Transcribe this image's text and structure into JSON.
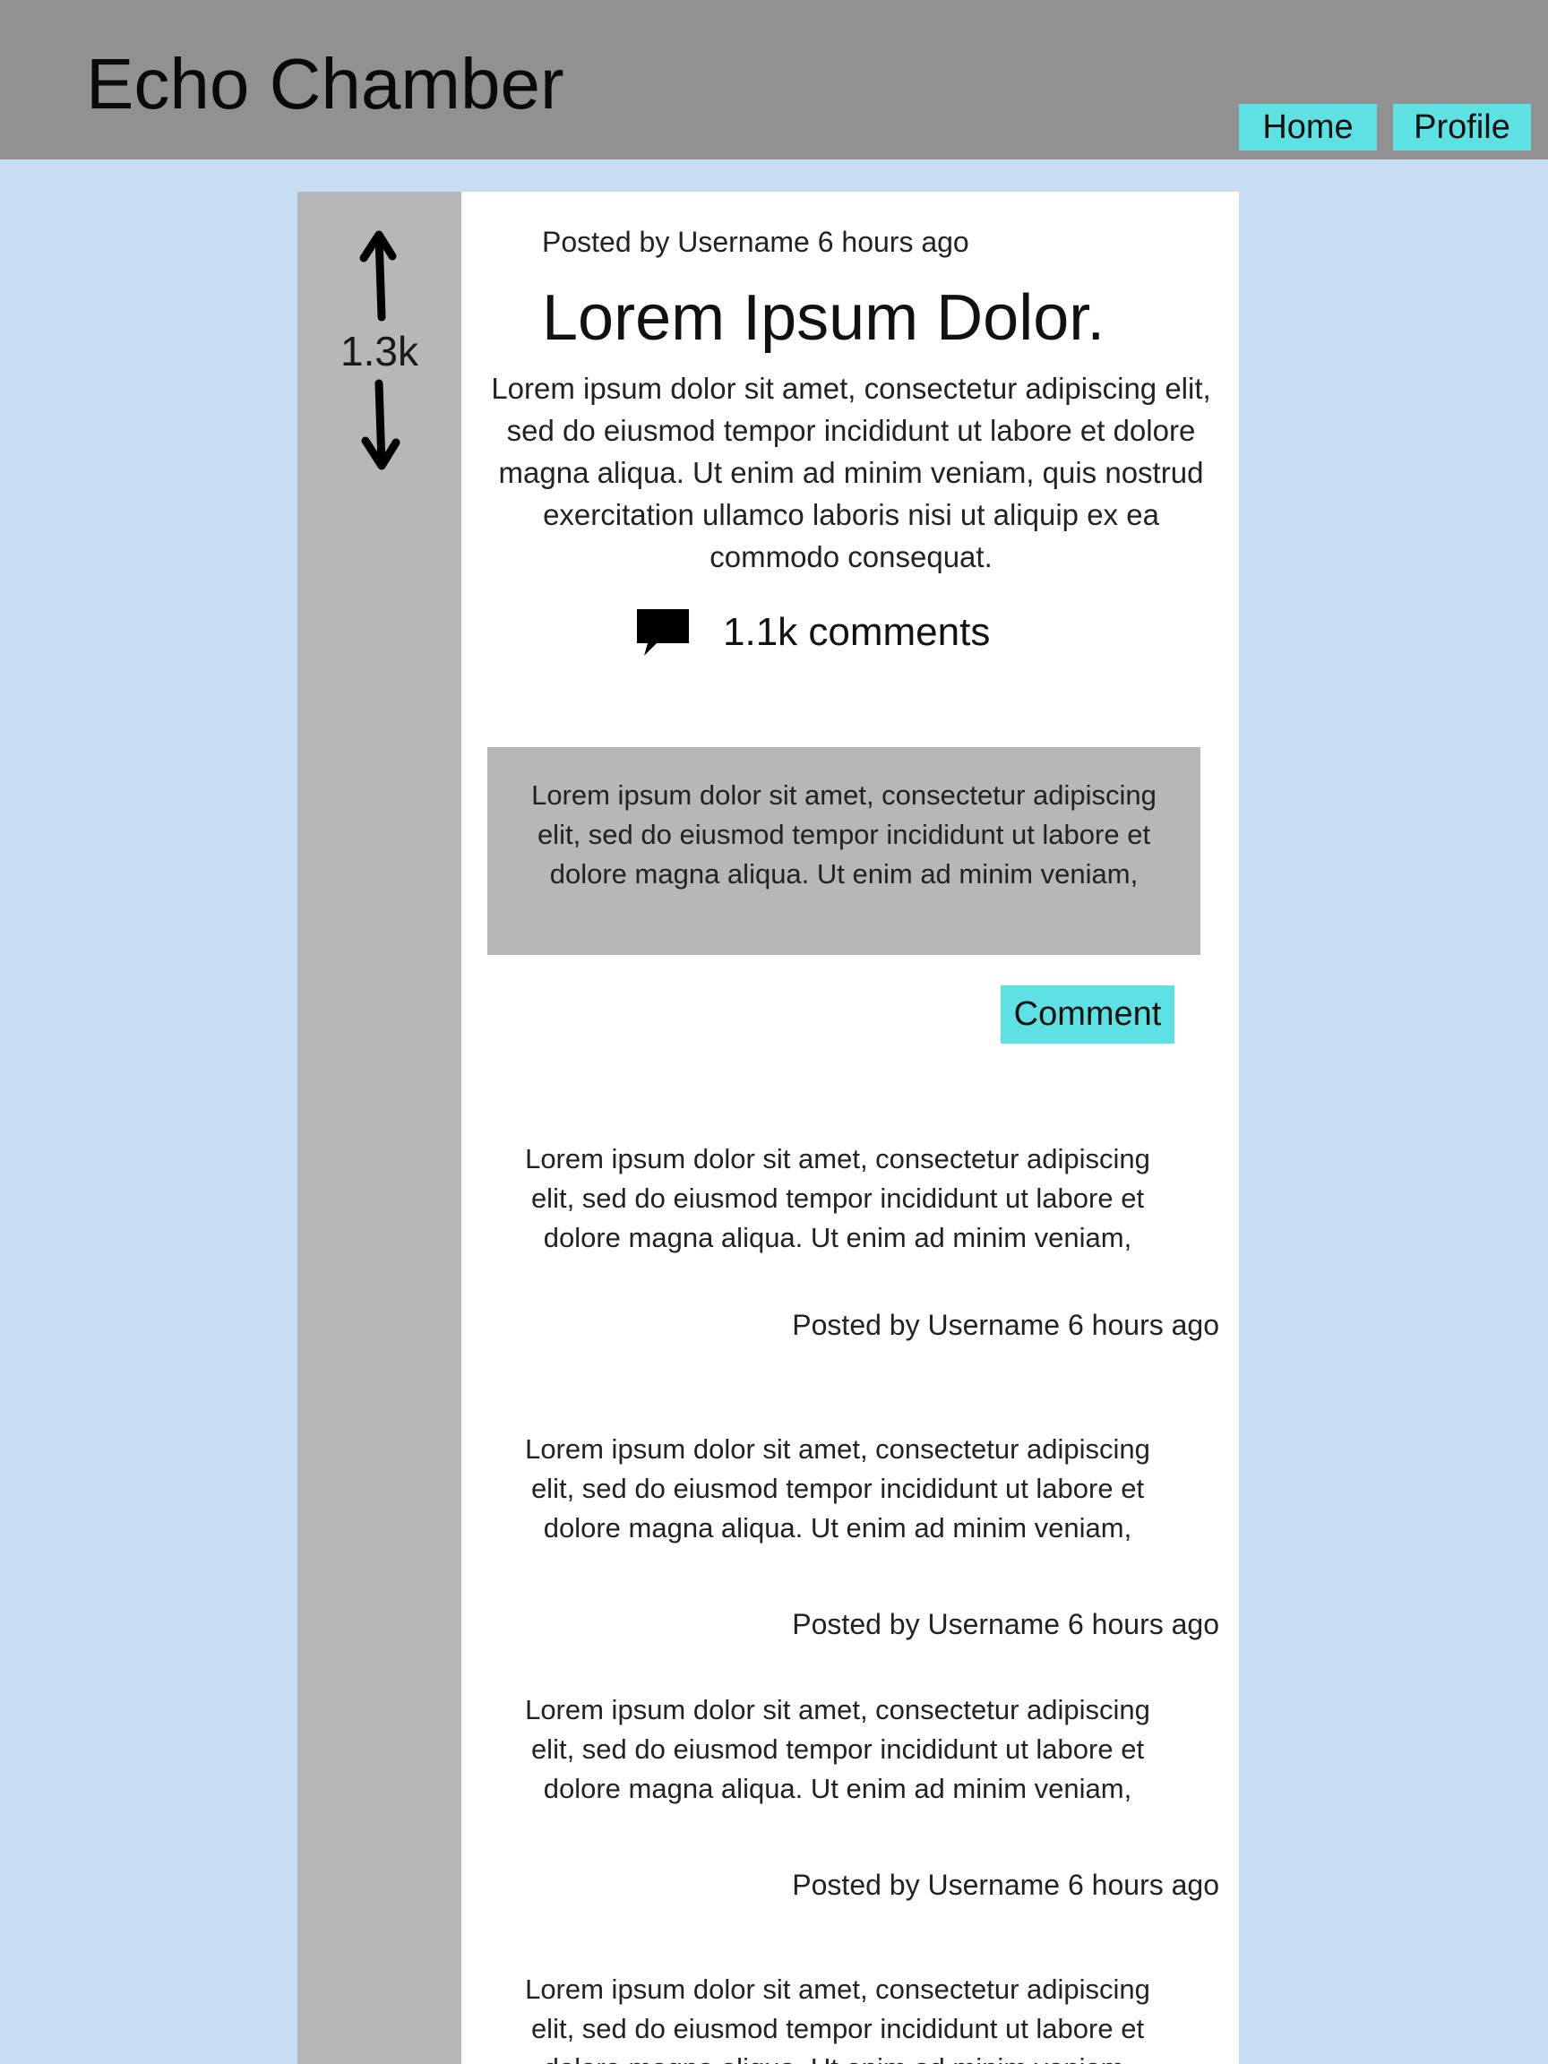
{
  "header": {
    "title": "Echo Chamber",
    "nav": {
      "home": "Home",
      "profile": "Profile"
    }
  },
  "colors": {
    "background": "#c6ddf2",
    "header": "#919191",
    "sidebar": "#b7b7b7",
    "panel": "#ffffff",
    "accent": "#5ee1e3",
    "comment_box": "#b7b7b7"
  },
  "post": {
    "meta": "Posted by Username 6 hours ago",
    "title": "Lorem Ipsum Dolor.",
    "body": "Lorem ipsum dolor sit amet, consectetur adipiscing elit, sed do eiusmod tempor incididunt ut labore et dolore magna aliqua. Ut enim ad minim veniam, quis nostrud exercitation ullamco laboris nisi ut aliquip ex ea commodo consequat.",
    "votes": "1.3k",
    "comments_label": "1.1k comments",
    "icons": {
      "upvote": "arrow-up-icon",
      "downvote": "arrow-down-icon",
      "comments": "speech-bubble-icon"
    }
  },
  "comment_form": {
    "text": "Lorem ipsum dolor sit amet, consectetur adipiscing elit, sed do eiusmod tempor incididunt ut labore et dolore magna aliqua. Ut enim ad minim veniam,",
    "button_label": "Comment"
  },
  "comments": [
    {
      "text": "Lorem ipsum dolor sit amet, consectetur adipiscing elit, sed do eiusmod tempor incididunt ut labore et dolore magna aliqua. Ut enim ad minim veniam,",
      "meta": "Posted by Username 6 hours ago"
    },
    {
      "text": "Lorem ipsum dolor sit amet, consectetur adipiscing elit, sed do eiusmod tempor incididunt ut labore et dolore magna aliqua. Ut enim ad minim veniam,",
      "meta": "Posted by Username 6 hours ago"
    },
    {
      "text": "Lorem ipsum dolor sit amet, consectetur adipiscing elit, sed do eiusmod tempor incididunt ut labore et dolore magna aliqua. Ut enim ad minim veniam,",
      "meta": "Posted by Username 6 hours ago"
    },
    {
      "text": "Lorem ipsum dolor sit amet, consectetur adipiscing elit, sed do eiusmod tempor incididunt ut labore et dolore magna aliqua. Ut enim ad minim veniam,"
    }
  ]
}
